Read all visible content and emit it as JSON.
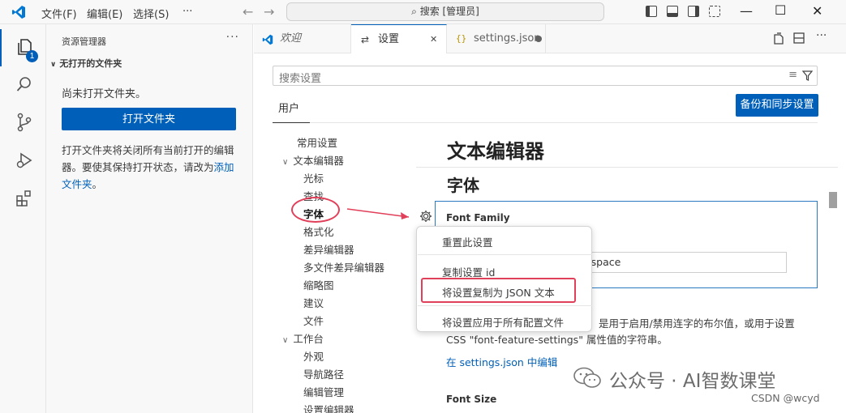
{
  "titlebar": {
    "menus": [
      "文件(F)",
      "编辑(E)",
      "选择(S)",
      "···"
    ],
    "search": "搜索 [管理员]"
  },
  "activity": {
    "explorer_badge": "1"
  },
  "sidebar": {
    "title": "资源管理器",
    "more": "···",
    "section": "无打开的文件夹",
    "no_folder_text": "尚未打开文件夹。",
    "open_folder_button": "打开文件夹",
    "hint_text": "打开文件夹将关闭所有当前打开的编辑器。要使其保持打开状态，请改为",
    "hint_link": "添加文件夹",
    "hint_end": "。"
  },
  "tabs": [
    {
      "label": "欢迎",
      "icon": "vscode-icon"
    },
    {
      "label": "设置",
      "icon": "settings-icon",
      "close": "✕"
    },
    {
      "label": "settings.json",
      "icon": "json-icon"
    }
  ],
  "settings": {
    "search_placeholder": "搜索设置",
    "user_tab": "用户",
    "sync_button": "备份和同步设置",
    "toc": [
      "常用设置",
      "文本编辑器",
      "光标",
      "查找",
      "字体",
      "格式化",
      "差异编辑器",
      "多文件差异编辑器",
      "缩略图",
      "建议",
      "文件",
      "工作台",
      "外观",
      "导航路径",
      "编辑管理",
      "设置编辑器"
    ],
    "heading": "文本编辑器",
    "section": "字体",
    "font_family_label": "Font Family",
    "font_family_value": "ospace",
    "description_line1": "是用于启用/禁用连字的布尔值，或用于设置",
    "description_line2": "CSS \"font-feature-settings\" 属性值的字符串。",
    "edit_link": "在 settings.json 中编辑",
    "font_size_label": "Font Size"
  },
  "context_menu": {
    "items": [
      "重置此设置",
      "复制设置 id",
      "将设置复制为 JSON 文本",
      "将设置应用于所有配置文件"
    ]
  },
  "watermark": {
    "text": "公众号 · AI智数课堂",
    "csdn": "CSDN @wcyd"
  },
  "colors": {
    "accent": "#005fb8",
    "annotation": "#e1405a"
  }
}
